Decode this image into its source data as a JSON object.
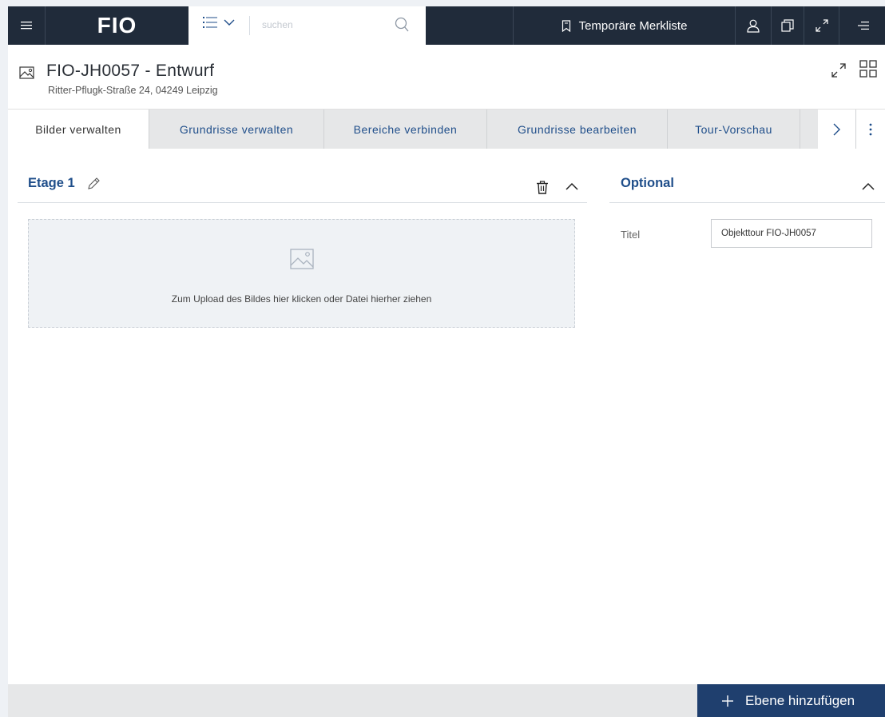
{
  "topbar": {
    "logo": "FIO",
    "search_placeholder": "suchen",
    "merkliste_label": "Temporäre Merkliste"
  },
  "header": {
    "title": "FIO-JH0057 - Entwurf",
    "address": "Ritter-Pflugk-Straße 24, 04249 Leipzig"
  },
  "tabs": [
    {
      "label": "Bilder verwalten",
      "active": true
    },
    {
      "label": "Grundrisse verwalten",
      "active": false
    },
    {
      "label": "Bereiche verbinden",
      "active": false
    },
    {
      "label": "Grundrisse bearbeiten",
      "active": false
    },
    {
      "label": "Tour-Vorschau",
      "active": false
    }
  ],
  "etage": {
    "title": "Etage 1",
    "upload_text": "Zum Upload des Bildes hier klicken oder Datei hierher ziehen"
  },
  "optional": {
    "title": "Optional",
    "titel_label": "Titel",
    "titel_value": "Objekttour FIO-JH0057"
  },
  "footer": {
    "add_level_label": "Ebene hinzufügen"
  },
  "colors": {
    "topbar": "#202b3a",
    "accent": "#1f4e8a",
    "primary_button": "#1f3f6e"
  }
}
